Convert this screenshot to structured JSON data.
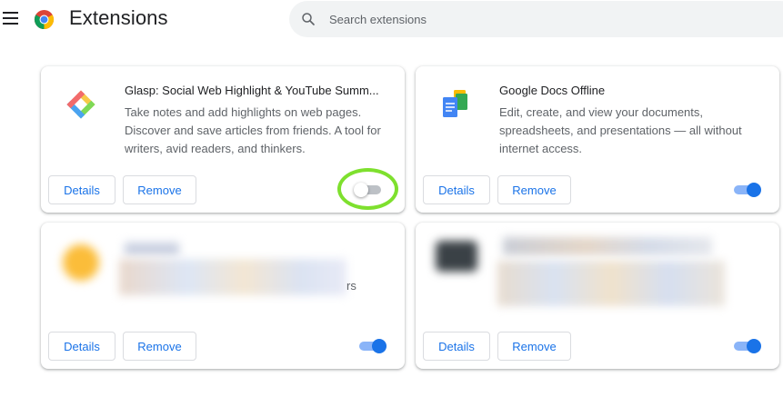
{
  "header": {
    "title": "Extensions",
    "search_placeholder": "Search extensions"
  },
  "colors": {
    "accent": "#1a73e8",
    "toggle_track_on": "#8ab4f8",
    "highlight_ring": "#7ee02e"
  },
  "extensions": [
    {
      "name": "Glasp: Social Web Highlight & YouTube Summ...",
      "description": "Take notes and add highlights on web pages. Discover and save articles from friends. A tool for writers, avid readers, and thinkers.",
      "details_label": "Details",
      "remove_label": "Remove",
      "enabled": false,
      "icon": "glasp-icon"
    },
    {
      "name": "Google Docs Offline",
      "description": "Edit, create, and view your documents, spreadsheets, and presentations — all without internet access.",
      "details_label": "Details",
      "remove_label": "Remove",
      "enabled": true,
      "icon": "google-docs-icon"
    },
    {
      "name": "",
      "description_visible_fragment": "rs",
      "details_label": "Details",
      "remove_label": "Remove",
      "enabled": true,
      "icon": "blurred-extension-icon"
    },
    {
      "name": "",
      "description": "",
      "details_label": "Details",
      "remove_label": "Remove",
      "enabled": true,
      "icon": "blurred-extension-icon"
    }
  ]
}
